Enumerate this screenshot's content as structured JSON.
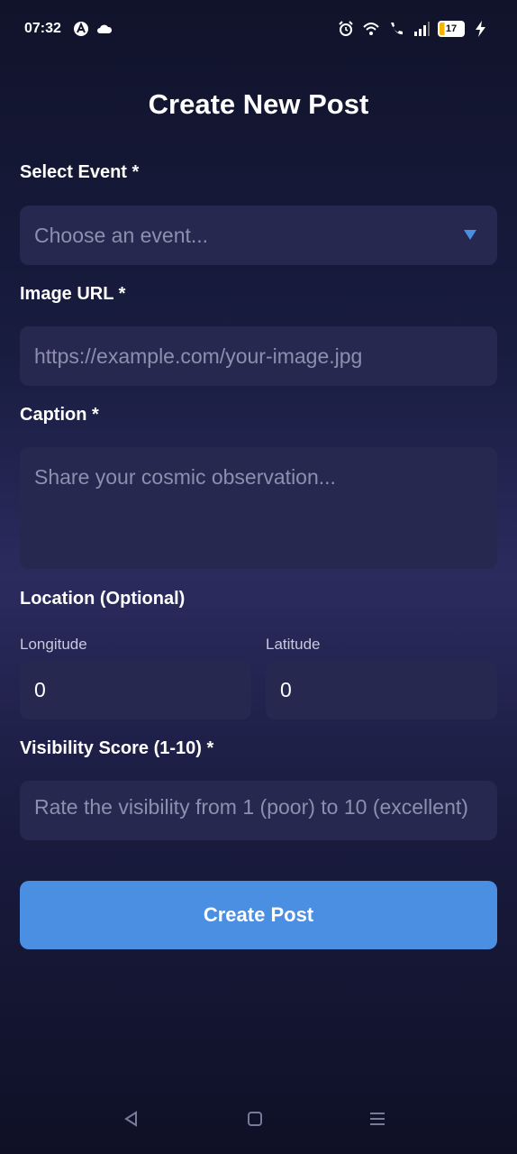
{
  "status_bar": {
    "time": "07:32",
    "battery_level": "17",
    "left_icons": [
      "app-a-icon",
      "cloud-icon"
    ],
    "right_icons": [
      "alarm-icon",
      "wifi-icon",
      "call-icon",
      "signal-icon",
      "battery-icon",
      "charging-icon"
    ]
  },
  "page": {
    "title": "Create New Post"
  },
  "form": {
    "event": {
      "label": "Select Event *",
      "placeholder": "Choose an event..."
    },
    "image_url": {
      "label": "Image URL *",
      "placeholder": "https://example.com/your-image.jpg"
    },
    "caption": {
      "label": "Caption *",
      "placeholder": "Share your cosmic observation..."
    },
    "location": {
      "label": "Location (Optional)",
      "longitude_label": "Longitude",
      "longitude_value": "0",
      "latitude_label": "Latitude",
      "latitude_value": "0"
    },
    "visibility": {
      "label": "Visibility Score (1-10) *",
      "placeholder": "Rate the visibility from 1 (poor) to 10 (excellent)"
    },
    "submit_label": "Create Post"
  },
  "colors": {
    "accent": "#4a8fe2",
    "field_bg": "#262850",
    "placeholder": "#8d8fae"
  },
  "nav_bar": {
    "items": [
      "back-icon",
      "home-icon",
      "recents-icon"
    ]
  }
}
